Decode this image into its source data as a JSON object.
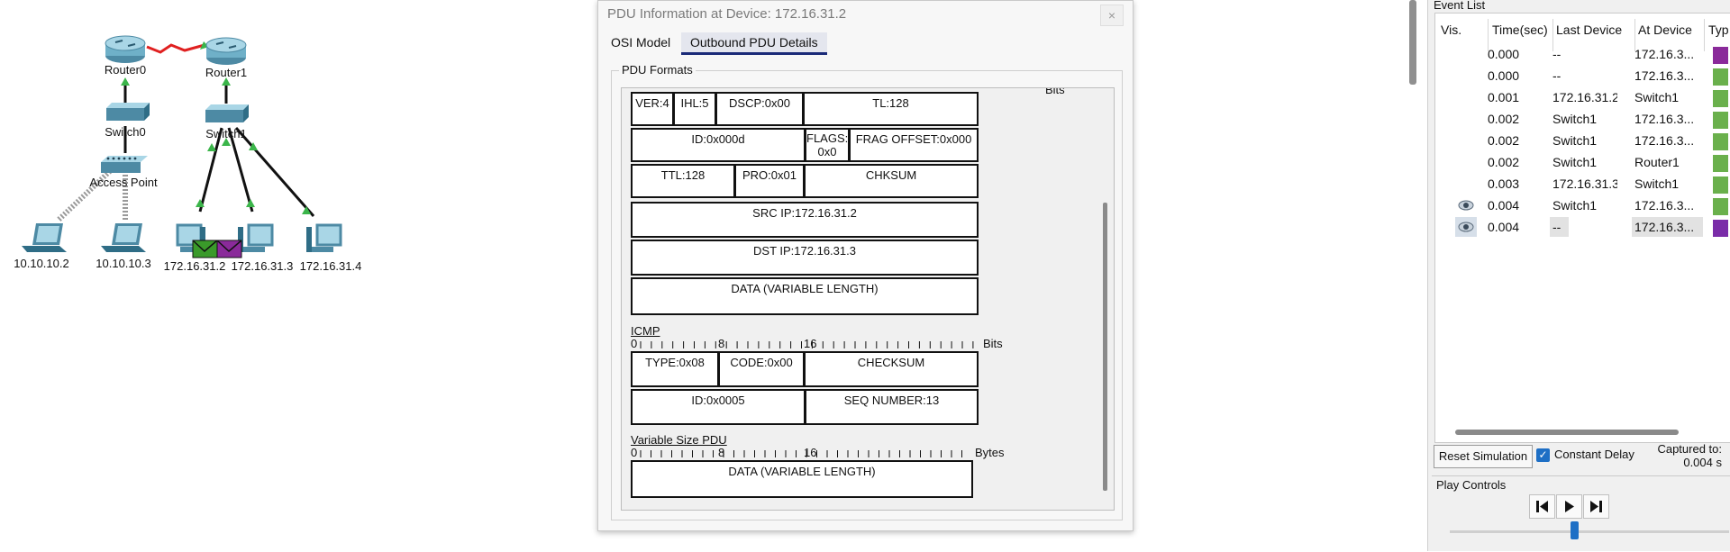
{
  "topology": {
    "devices": [
      {
        "label": "Router0",
        "type": "router"
      },
      {
        "label": "Router1",
        "type": "router"
      },
      {
        "label": "Switch0",
        "type": "switch"
      },
      {
        "label": "Switch1",
        "type": "switch"
      },
      {
        "label": "Access Point",
        "type": "access-point"
      },
      {
        "label": "10.10.10.2",
        "type": "laptop"
      },
      {
        "label": "10.10.10.3",
        "type": "laptop"
      },
      {
        "label": "172.16.31.2",
        "type": "pc"
      },
      {
        "label": "172.16.31.3",
        "type": "pc"
      },
      {
        "label": "172.16.31.4",
        "type": "pc"
      }
    ],
    "colors": {
      "link": "#111111",
      "serial_link": "#e02020",
      "port_up": "#3bb54a",
      "pdu_green": "#3a9a2a",
      "pdu_purple": "#8a2a9a"
    }
  },
  "pdu_dialog": {
    "title": "PDU Information at Device: 172.16.31.2",
    "close_label": "×",
    "tabs": [
      {
        "label": "OSI Model",
        "selected": false
      },
      {
        "label": "Outbound PDU Details",
        "selected": true
      }
    ],
    "group_title": "PDU Formats",
    "ip_rows": {
      "ver": "VER:4",
      "ihl": "IHL:5",
      "dscp": "DSCP:0x00",
      "tl": "TL:128",
      "id": "ID:0x000d",
      "flags_1": "FLAGS:",
      "flags_2": "0x0",
      "frag": "FRAG OFFSET:0x000",
      "ttl": "TTL:128",
      "pro": "PRO:0x01",
      "chksum": "CHKSUM",
      "src": "SRC IP:172.16.31.2",
      "dst": "DST IP:172.16.31.3",
      "data": "DATA (VARIABLE LENGTH)"
    },
    "icmp": {
      "title": "ICMP",
      "ticks": [
        "0",
        "8",
        "16"
      ],
      "unit": "Bits",
      "type": "TYPE:0x08",
      "code": "CODE:0x00",
      "checksum": "CHECKSUM",
      "id": "ID:0x0005",
      "seq": "SEQ NUMBER:13"
    },
    "variable": {
      "title": "Variable Size PDU",
      "ticks": [
        "0",
        "8",
        "16"
      ],
      "unit": "Bytes",
      "data": "DATA (VARIABLE LENGTH)"
    },
    "top_unit": "Bits"
  },
  "event_list": {
    "title": "Event List",
    "headers": [
      "Vis.",
      "Time(sec)",
      "Last Device",
      "At Device",
      "Typ"
    ],
    "rows": [
      {
        "vis": "",
        "time": "0.000",
        "last": "--",
        "at": "172.16.3...",
        "color": "#8a2a9a",
        "selected": false
      },
      {
        "vis": "",
        "time": "0.000",
        "last": "--",
        "at": "172.16.3...",
        "color": "#6ab04c",
        "selected": false
      },
      {
        "vis": "",
        "time": "0.001",
        "last": "172.16.31.2",
        "at": "Switch1",
        "color": "#6ab04c",
        "selected": false
      },
      {
        "vis": "",
        "time": "0.002",
        "last": "Switch1",
        "at": "172.16.3...",
        "color": "#6ab04c",
        "selected": false
      },
      {
        "vis": "",
        "time": "0.002",
        "last": "Switch1",
        "at": "172.16.3...",
        "color": "#6ab04c",
        "selected": false
      },
      {
        "vis": "",
        "time": "0.002",
        "last": "Switch1",
        "at": "Router1",
        "color": "#6ab04c",
        "selected": false
      },
      {
        "vis": "",
        "time": "0.003",
        "last": "172.16.31.3",
        "at": "Switch1",
        "color": "#6ab04c",
        "selected": false
      },
      {
        "vis": "eye",
        "time": "0.004",
        "last": "Switch1",
        "at": "172.16.3...",
        "color": "#6ab04c",
        "selected": false
      },
      {
        "vis": "eye",
        "time": "0.004",
        "last": "--",
        "at": "172.16.3...",
        "color": "#7a2ca8",
        "selected": true
      }
    ]
  },
  "sim_controls": {
    "reset_label": "Reset Simulation",
    "constant_delay_label": "Constant Delay",
    "constant_delay_checked": true,
    "captured_label": "Captured to:",
    "captured_value": "0.004 s",
    "play_controls_title": "Play Controls",
    "buttons": [
      "back-icon",
      "play-icon",
      "forward-icon"
    ]
  }
}
